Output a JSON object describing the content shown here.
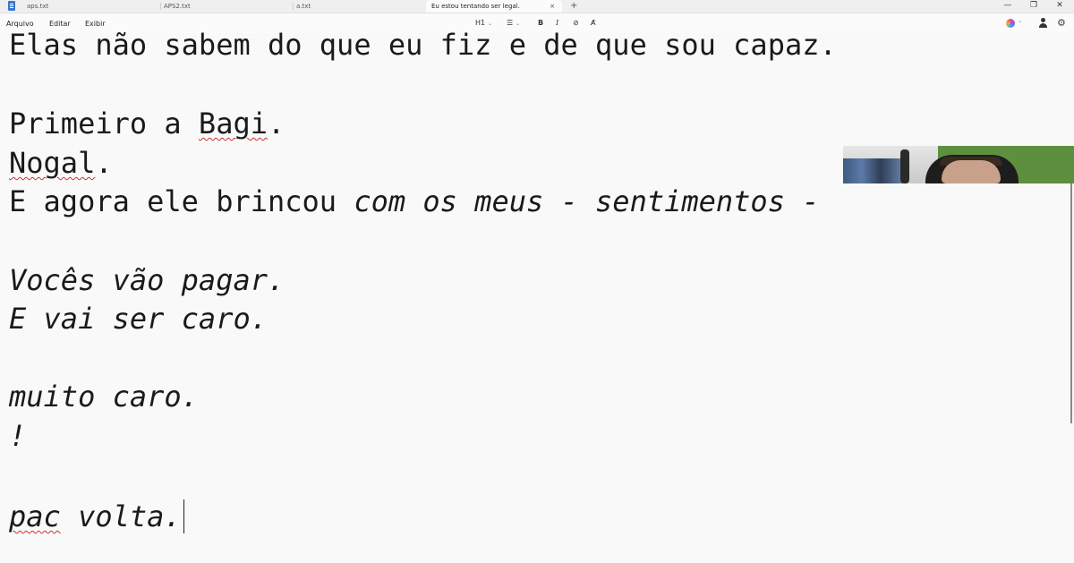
{
  "tabs": [
    {
      "label": "aps.txt",
      "active": false
    },
    {
      "label": "APS2.txt",
      "active": false
    },
    {
      "label": "a.txt",
      "active": false
    },
    {
      "label": "Eu estou tentando ser legal.",
      "active": true,
      "close": "×"
    }
  ],
  "new_tab": "+",
  "window_controls": {
    "minimize": "—",
    "restore": "❐",
    "close": "✕"
  },
  "menu": [
    "Arquivo",
    "Editar",
    "Exibir"
  ],
  "toolbar": {
    "heading": "H1",
    "list": "☰",
    "bold": "B",
    "italic": "I",
    "link": "⊘",
    "clear_format": "A̸",
    "chevron": "⌄"
  },
  "gear_glyph": "⚙",
  "document": {
    "lines": [
      {
        "segments": [
          {
            "text": "Elas não sabem do que eu fiz e de que sou capaz."
          }
        ]
      },
      {
        "segments": [
          {
            "text": "Primeiro a "
          },
          {
            "text": "Bagi",
            "spell": true
          },
          {
            "text": "."
          }
        ]
      },
      {
        "segments": [
          {
            "text": "Nogal",
            "spell": true
          },
          {
            "text": "."
          }
        ]
      },
      {
        "segments": [
          {
            "text": "E agora ele brincou "
          },
          {
            "text": "com os meus - sentimentos -",
            "italic": true
          }
        ]
      },
      {
        "segments": [
          {
            "text": "Vocês vão pagar.",
            "italic": true
          }
        ]
      },
      {
        "segments": [
          {
            "text": "E vai ser caro.",
            "italic": true
          }
        ]
      },
      {
        "segments": [
          {
            "text": "muito caro.",
            "italic": true
          }
        ]
      },
      {
        "segments": [
          {
            "text": "!",
            "italic": true
          }
        ]
      },
      {
        "segments": [
          {
            "text": "pac",
            "italic": true,
            "spell": true
          },
          {
            "text": " volta.",
            "italic": true
          }
        ],
        "caret": true
      }
    ]
  },
  "colors": {
    "background": "#f9f9f9",
    "tabbar": "#efefef",
    "text": "#1a1a1a",
    "spellcheck": "#d03030"
  }
}
